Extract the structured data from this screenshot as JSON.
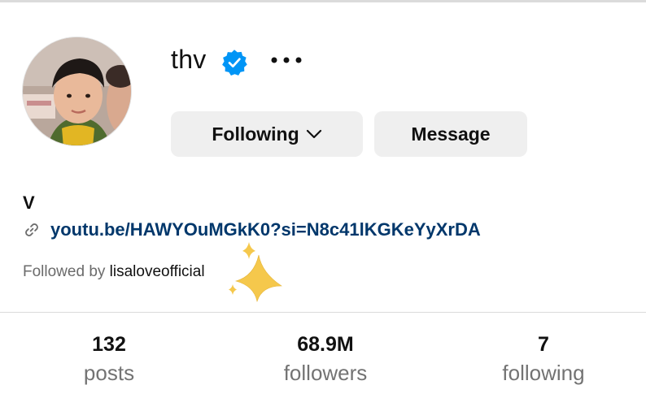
{
  "profile": {
    "username": "thv",
    "full_name": "V",
    "link": "youtu.be/HAWYOuMGkK0?si=N8c41lKGKeYyXrDA",
    "followed_by_prefix": "Followed by ",
    "followed_by_user": "lisaloveofficial"
  },
  "buttons": {
    "following_label": "Following",
    "message_label": "Message"
  },
  "stats": {
    "posts_value": "132",
    "posts_label": "posts",
    "followers_value": "68.9M",
    "followers_label": "followers",
    "following_value": "7",
    "following_label": "following"
  },
  "icons": {
    "verified": "verified-badge-icon",
    "more": "more-options-icon",
    "chevron": "chevron-down-icon",
    "link": "link-icon",
    "sparkles": "sparkles-icon"
  },
  "colors": {
    "verified_blue": "#0095f6",
    "link_blue": "#00376b",
    "button_bg": "#efefef",
    "muted_text": "#737373",
    "sparkle_gold": "#f5c84c"
  }
}
